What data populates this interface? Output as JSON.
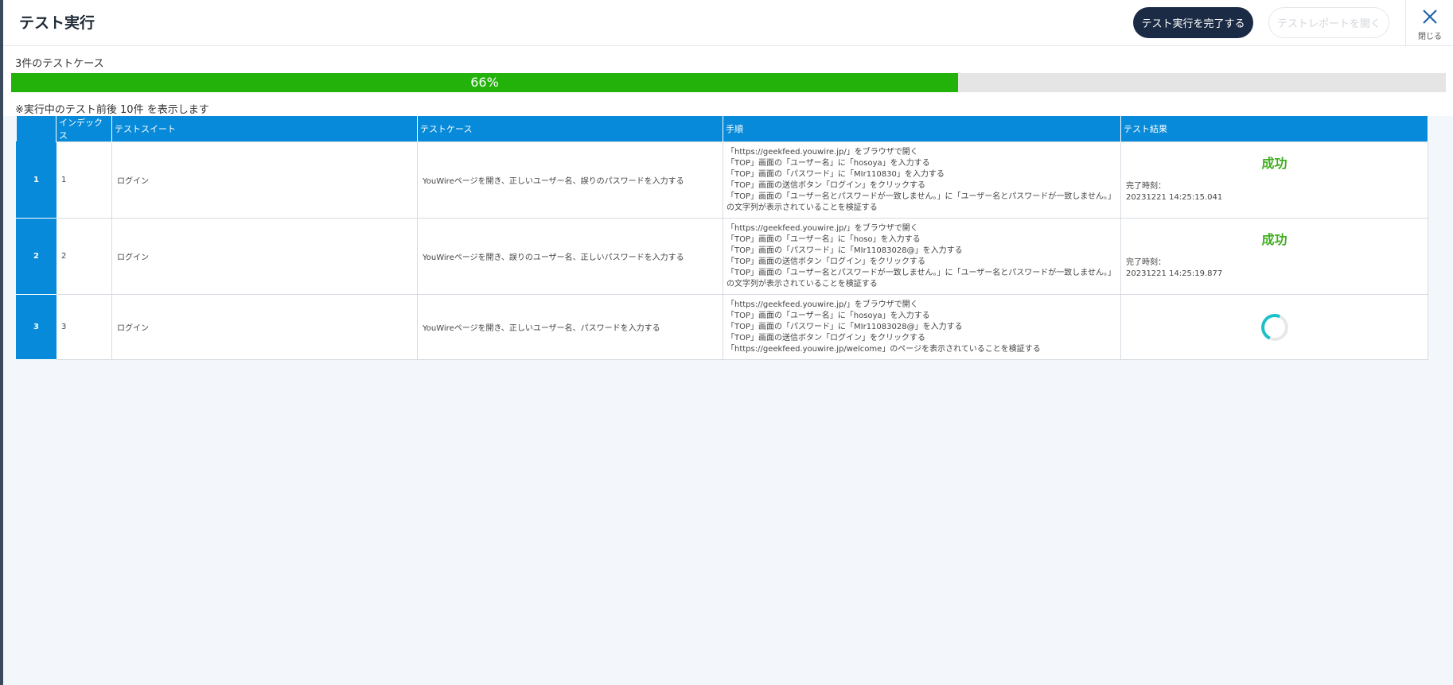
{
  "header": {
    "title": "テスト実行",
    "complete_button": "テスト実行を完了する",
    "report_button": "テストレポートを開く",
    "close_label": "閉じる"
  },
  "summary": {
    "count_text": "3件のテストケース",
    "progress_label": "66%",
    "progress_value": 66,
    "note": "※実行中のテスト前後 10件 を表示します"
  },
  "table": {
    "columns": [
      "",
      "インデックス",
      "テストスイート",
      "テストケース",
      "手順",
      "テスト結果"
    ],
    "rows": [
      {
        "num": "1",
        "index": "1",
        "suite": "ログイン",
        "case": "YouWireページを開き、正しいユーザー名、誤りのパスワードを入力する",
        "steps": [
          "「https://geekfeed.youwire.jp/」をブラウザで開く",
          "「TOP」画面の「ユーザー名」に「hosoya」を入力する",
          "「TOP」画面の「パスワード」に「MIr110830」を入力する",
          "「TOP」画面の送信ボタン「ログイン」をクリックする",
          "「TOP」画面の「ユーザー名とパスワードが一致しません。」に「ユーザー名とパスワードが一致しません。」の文字列が表示されていることを検証する"
        ],
        "result": "成功",
        "done_label": "完了時刻：",
        "done_time": "20231221 14:25:15.041"
      },
      {
        "num": "2",
        "index": "2",
        "suite": "ログイン",
        "case": "YouWireページを開き、誤りのユーザー名、正しいパスワードを入力する",
        "steps": [
          "「https://geekfeed.youwire.jp/」をブラウザで開く",
          "「TOP」画面の「ユーザー名」に「hoso」を入力する",
          "「TOP」画面の「パスワード」に「MIr11083028@」を入力する",
          "「TOP」画面の送信ボタン「ログイン」をクリックする",
          "「TOP」画面の「ユーザー名とパスワードが一致しません。」に「ユーザー名とパスワードが一致しません。」の文字列が表示されていることを検証する"
        ],
        "result": "成功",
        "done_label": "完了時刻：",
        "done_time": "20231221 14:25:19.877"
      },
      {
        "num": "3",
        "index": "3",
        "suite": "ログイン",
        "case": "YouWireページを開き、正しいユーザー名、パスワードを入力する",
        "steps": [
          "「https://geekfeed.youwire.jp/」をブラウザで開く",
          "「TOP」画面の「ユーザー名」に「hosoya」を入力する",
          "「TOP」画面の「パスワード」に「MIr11083028@」を入力する",
          "「TOP」画面の送信ボタン「ログイン」をクリックする",
          "「https://geekfeed.youwire.jp/welcome」のページを表示されていることを検証する"
        ],
        "status": "running"
      }
    ]
  },
  "colors": {
    "header_blue": "#078ad9",
    "progress_green": "#22b20a",
    "success_green": "#3fae1f",
    "primary_button": "#1b2b45",
    "spinner": "#1bc0c9"
  }
}
